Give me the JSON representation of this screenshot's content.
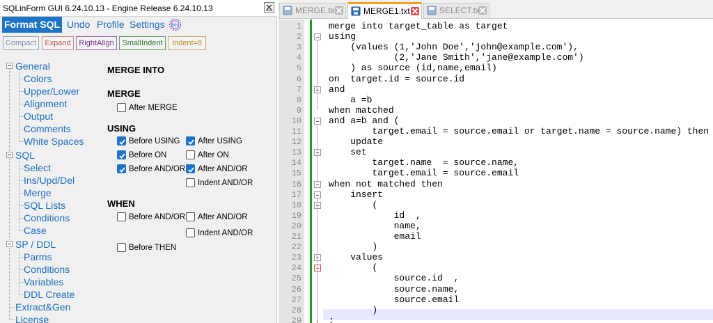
{
  "window": {
    "title": "SQLinForm GUI 6.24.10.13 - Engine Release 6.24.10.13"
  },
  "menu": {
    "format_sql": "Format SQL",
    "undo": "Undo",
    "profile": "Profile",
    "settings": "Settings"
  },
  "quick_buttons": {
    "compact": "Compact",
    "expand": "Expand",
    "right_align": "RightAlign",
    "small_indent": "SmallIndent",
    "indent": "Indent=8"
  },
  "tree": {
    "general": "General",
    "colors": "Colors",
    "upper_lower": "Upper/Lower",
    "alignment": "Alignment",
    "output": "Output",
    "comments": "Comments",
    "white_spaces": "White Spaces",
    "sql": "SQL",
    "select": "Select",
    "ins_upd_del": "Ins/Upd/Del",
    "merge": "Merge",
    "sql_lists": "SQL Lists",
    "conditions": "Conditions",
    "case": "Case",
    "sp_ddl": "SP / DDL",
    "parms": "Parms",
    "sp_conditions": "Conditions",
    "variables": "Variables",
    "ddl_create": "DDL Create",
    "extract_gen": "Extract&Gen",
    "license": "License"
  },
  "options": {
    "heading": "MERGE INTO",
    "merge": {
      "title": "MERGE",
      "after_merge": {
        "label": "After MERGE",
        "checked": false
      }
    },
    "using": {
      "title": "USING",
      "before_using": {
        "label": "Before USING",
        "checked": true
      },
      "after_using": {
        "label": "After USING",
        "checked": true
      },
      "before_on": {
        "label": "Before ON",
        "checked": true
      },
      "after_on": {
        "label": "After ON",
        "checked": false
      },
      "before_and_or": {
        "label": "Before AND/OR",
        "checked": true
      },
      "after_and_or": {
        "label": "After AND/OR",
        "checked": true
      },
      "indent_and_or": {
        "label": "Indent AND/OR",
        "checked": false
      }
    },
    "when": {
      "title": "WHEN",
      "before_and_or": {
        "label": "Before AND/OR",
        "checked": false
      },
      "after_and_or": {
        "label": "After AND/OR",
        "checked": false
      },
      "indent_and_or": {
        "label": "Indent AND/OR",
        "checked": false
      },
      "before_then": {
        "label": "Before THEN",
        "checked": false
      }
    }
  },
  "tabs": [
    {
      "name": "MERGE.txt",
      "active": false
    },
    {
      "name": "MERGE1.txt",
      "active": true
    },
    {
      "name": "SELECT.txt",
      "active": false
    }
  ],
  "editor": {
    "lines": [
      "merge into target_table as target",
      "using",
      "    (values (1,'John Doe','john@example.com'),",
      "            (2,'Jane Smith','jane@example.com')",
      "    ) as source (id,name,email)",
      "on  target.id = source.id",
      "and",
      "    a =b",
      "when matched",
      "and a=b and (",
      "        target.email = source.email or target.name = source.name) then",
      "    update",
      "    set",
      "        target.name  = source.name,",
      "        target.email = source.email",
      "when not matched then",
      "    insert",
      "        (",
      "            id  ,",
      "            name,",
      "            email",
      "        )",
      "    values",
      "        (",
      "            source.id  ,",
      "            source.name,",
      "            source.email",
      "        )",
      ";"
    ]
  },
  "colors": {
    "accent_blue": "#1d74c7",
    "link_blue": "#1c6fc1",
    "change_bar_green": "#1aa01a",
    "active_tab_orange": "#f7a21a",
    "close_red": "#e24b4b"
  }
}
